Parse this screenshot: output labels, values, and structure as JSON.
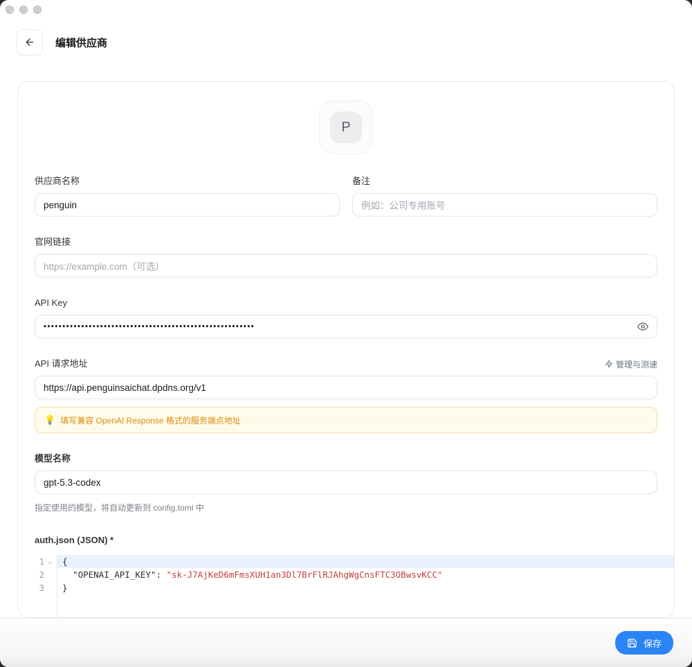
{
  "window": {
    "title": "编辑供应商"
  },
  "avatar": {
    "letter": "P"
  },
  "form": {
    "provider_name": {
      "label": "供应商名称",
      "value": "penguin"
    },
    "note": {
      "label": "备注",
      "placeholder": "例如：公司专用账号"
    },
    "website": {
      "label": "官网链接",
      "placeholder": "https://example.com（可选）"
    },
    "api_key": {
      "label": "API Key",
      "masked_value": "••••••••••••••••••••••••••••••••••••••••••••••••••••••••"
    },
    "api_url": {
      "label": "API 请求地址",
      "action_label": "管理与测速",
      "value": "https://api.penguinsaichat.dpdns.org/v1"
    },
    "hint": {
      "icon": "💡",
      "text": "填写兼容 OpenAI Response 格式的服务端点地址"
    },
    "model_name": {
      "label": "模型名称",
      "value": "gpt-5.3-codex",
      "helper": "指定使用的模型，将自动更新到 config.toml 中"
    },
    "auth_json": {
      "label": "auth.json (JSON) *",
      "line1_num": "1",
      "line1_code": "{",
      "line2_num": "2",
      "line2_key": "  \"OPENAI_API_KEY\": ",
      "line2_value": "\"sk-J7AjKeD6mFmsXUH1an3Dl7BrFlRJAhgWgCnsFTC3OBwsvKCC\"",
      "line3_num": "3",
      "line3_code": "}"
    }
  },
  "footer": {
    "save_label": "保存"
  },
  "colors": {
    "accent_blue": "#2a84f6",
    "hint_background": "#fffbeb",
    "hint_border": "#f6dca6",
    "hint_text": "#dd8b0c",
    "code_string": "#c0403c",
    "active_line": "#e9f1fd"
  }
}
